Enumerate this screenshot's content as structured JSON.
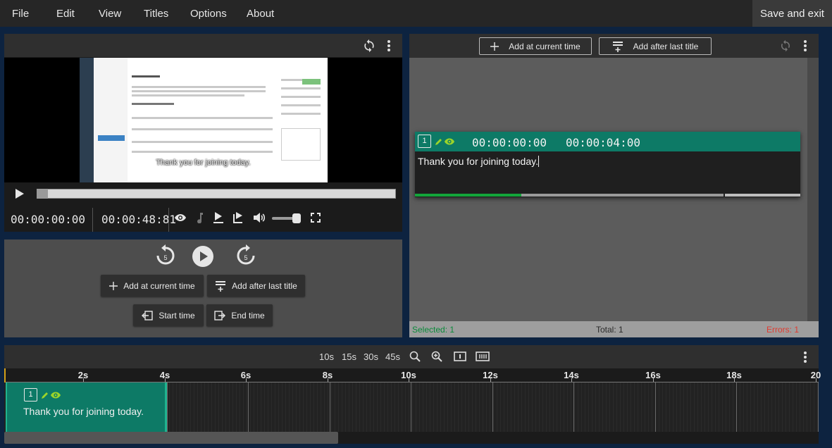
{
  "menu": {
    "items": [
      "File",
      "Edit",
      "View",
      "Titles",
      "Options",
      "About"
    ],
    "save_exit": "Save and exit"
  },
  "video": {
    "caption": "Thank you for joining today.",
    "current_time": "00:00:00:00",
    "duration": "00:00:48:81",
    "volume": 0.9,
    "progress": 0.0
  },
  "controls": {
    "rewind_seconds": "5",
    "forward_seconds": "5",
    "add_current": "Add at current time",
    "add_after": "Add after last title",
    "start_time": "Start time",
    "end_time": "End time"
  },
  "editor": {
    "add_current": "Add at current time",
    "add_after": "Add after last title",
    "title": {
      "number": "1",
      "start": "00:00:00:00",
      "end": "00:00:04:00",
      "text": "Thank you for joining today."
    },
    "status": {
      "selected": "Selected: 1",
      "total": "Total: 1",
      "errors": "Errors: 1"
    }
  },
  "timeline": {
    "zoom_options": [
      "10s",
      "15s",
      "30s",
      "45s"
    ],
    "ticks": [
      "2s",
      "4s",
      "6s",
      "8s",
      "10s",
      "12s",
      "14s",
      "16s",
      "18s",
      "20"
    ],
    "clip": {
      "number": "1",
      "text": "Thank you for joining today."
    }
  },
  "colors": {
    "accent": "#0d7a66",
    "error": "#e03a2f",
    "selected": "#0a8a3a",
    "icon_green": "#9bd42a"
  }
}
